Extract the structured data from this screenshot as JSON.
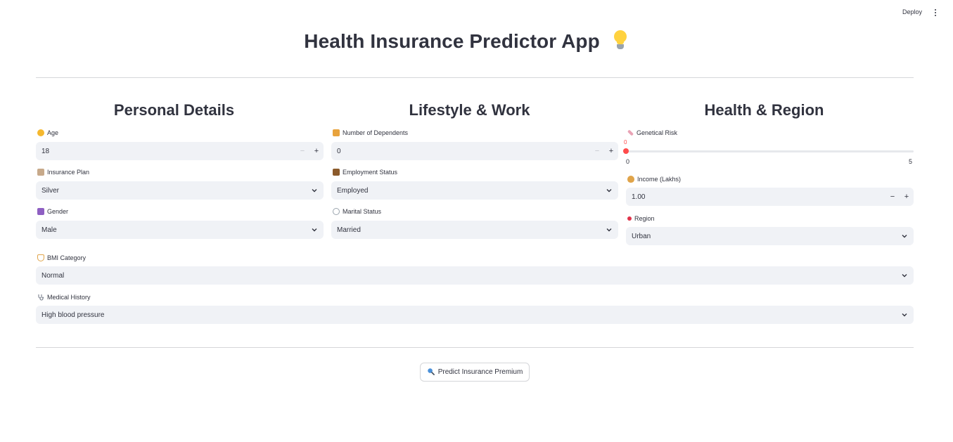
{
  "header": {
    "deploy_label": "Deploy"
  },
  "title": "Health Insurance Predictor App",
  "columns": {
    "personal": "Personal Details",
    "lifestyle": "Lifestyle & Work",
    "health": "Health & Region"
  },
  "fields": {
    "age": {
      "label": "Age",
      "value": "18",
      "icon": "grinning-face-icon"
    },
    "dependents": {
      "label": "Number of Dependents",
      "value": "0",
      "icon": "family-icon"
    },
    "genetical_risk": {
      "label": "Genetical Risk",
      "value": "0",
      "min": "0",
      "max": "5",
      "icon": "dna-icon"
    },
    "insurance_plan": {
      "label": "Insurance Plan",
      "value": "Silver",
      "icon": "document-icon"
    },
    "employment_status": {
      "label": "Employment Status",
      "value": "Employed",
      "icon": "briefcase-icon"
    },
    "income": {
      "label": "Income (Lakhs)",
      "value": "1.00",
      "icon": "money-bag-icon"
    },
    "gender": {
      "label": "Gender",
      "value": "Male",
      "icon": "gender-icon"
    },
    "marital_status": {
      "label": "Marital Status",
      "value": "Married",
      "icon": "ring-icon"
    },
    "region": {
      "label": "Region",
      "value": "Urban",
      "icon": "pin-icon"
    },
    "bmi_category": {
      "label": "BMI Category",
      "value": "Normal",
      "icon": "scale-icon"
    },
    "medical_history": {
      "label": "Medical History",
      "value": "High blood pressure",
      "icon": "stethoscope-icon"
    }
  },
  "button": {
    "label": "Predict Insurance Premium",
    "icon": "magnifier-icon"
  },
  "colors": {
    "accent": "#ff4b4b",
    "input_bg": "#f0f2f6",
    "text": "#31333f",
    "divider": "#d5d6d9"
  }
}
